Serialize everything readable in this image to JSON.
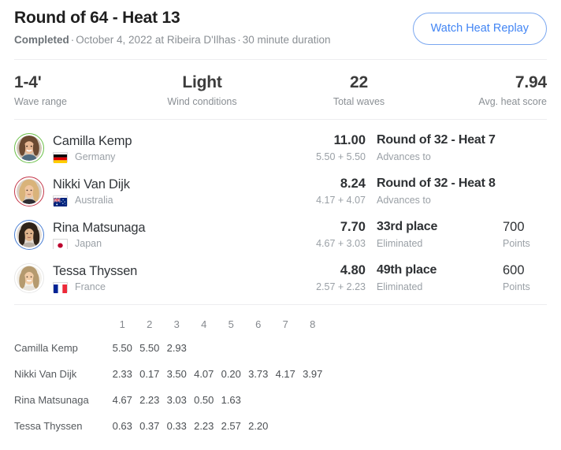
{
  "header": {
    "title": "Round of 64 - Heat 13",
    "status": "Completed",
    "sep1": "·",
    "date_location": "October 4, 2022 at Ribeira D'Ilhas",
    "sep2": "·",
    "duration": "30 minute duration",
    "replay_button": "Watch Heat Replay",
    "accent_color": "#4285f4"
  },
  "stats": [
    {
      "value": "1-4'",
      "label": "Wave range"
    },
    {
      "value": "Light",
      "label": "Wind conditions"
    },
    {
      "value": "22",
      "label": "Total waves"
    },
    {
      "value": "7.94",
      "label": "Avg. heat score"
    }
  ],
  "surfers": [
    {
      "name": "Camilla Kemp",
      "country": "Germany",
      "flag": "germany-flag",
      "ring_color": "#6cc04a",
      "total": "11.00",
      "breakdown": "5.50 + 5.50",
      "outcome": "Round of 32 - Heat 7",
      "outcome_sub": "Advances to",
      "points": "",
      "points_label": ""
    },
    {
      "name": "Nikki Van Dijk",
      "country": "Australia",
      "flag": "australia-flag",
      "ring_color": "#c4384a",
      "total": "8.24",
      "breakdown": "4.17 + 4.07",
      "outcome": "Round of 32 - Heat 8",
      "outcome_sub": "Advances to",
      "points": "",
      "points_label": ""
    },
    {
      "name": "Rina Matsunaga",
      "country": "Japan",
      "flag": "japan-flag",
      "ring_color": "#4a7fd4",
      "total": "7.70",
      "breakdown": "4.67 + 3.03",
      "outcome": "33rd place",
      "outcome_sub": "Eliminated",
      "points": "700",
      "points_label": "Points"
    },
    {
      "name": "Tessa Thyssen",
      "country": "France",
      "flag": "france-flag",
      "ring_color": "#e6e6e6",
      "total": "4.80",
      "breakdown": "2.57 + 2.23",
      "outcome": "49th place",
      "outcome_sub": "Eliminated",
      "points": "600",
      "points_label": "Points"
    }
  ],
  "wave_table": {
    "name_header": "",
    "columns": [
      "1",
      "2",
      "3",
      "4",
      "5",
      "6",
      "7",
      "8"
    ],
    "counted_color": "#eda13b",
    "rows": [
      {
        "name": "Camilla Kemp",
        "scores": [
          "5.50",
          "5.50",
          "2.93",
          "",
          "",
          "",
          "",
          ""
        ],
        "counted": [
          true,
          true,
          false,
          false,
          false,
          false,
          false,
          false
        ]
      },
      {
        "name": "Nikki Van Dijk",
        "scores": [
          "2.33",
          "0.17",
          "3.50",
          "4.07",
          "0.20",
          "3.73",
          "4.17",
          "3.97"
        ],
        "counted": [
          false,
          false,
          false,
          true,
          false,
          false,
          true,
          false
        ]
      },
      {
        "name": "Rina Matsunaga",
        "scores": [
          "4.67",
          "2.23",
          "3.03",
          "0.50",
          "1.63",
          "",
          "",
          ""
        ],
        "counted": [
          true,
          false,
          true,
          false,
          false,
          false,
          false,
          false
        ]
      },
      {
        "name": "Tessa Thyssen",
        "scores": [
          "0.63",
          "0.37",
          "0.33",
          "2.23",
          "2.57",
          "2.20",
          "",
          ""
        ],
        "counted": [
          false,
          false,
          false,
          true,
          true,
          false,
          false,
          false
        ]
      }
    ]
  }
}
